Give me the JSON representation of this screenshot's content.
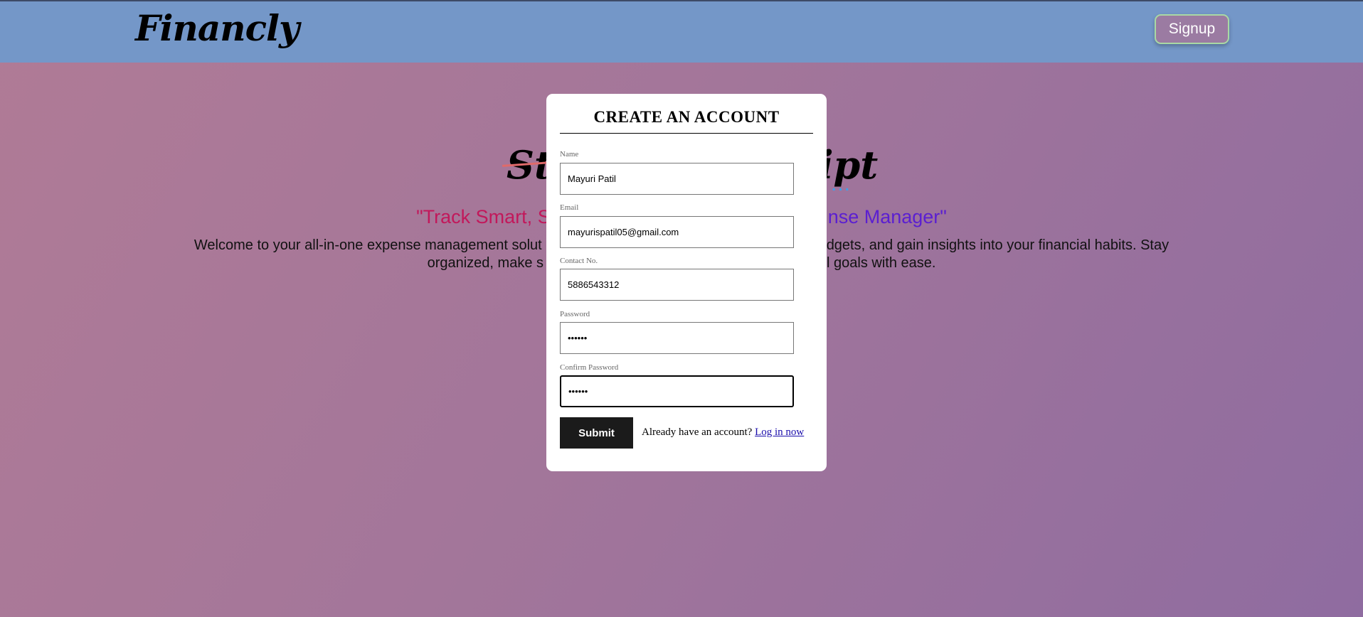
{
  "navbar": {
    "logo": "Financly",
    "signup_label": "Signup"
  },
  "hero": {
    "title_left": "St",
    "title_right": "ipt",
    "title_dots": "...",
    "tagline_left": "\"Track Smart, S",
    "tagline_right": "nse Manager\"",
    "welcome_line1_left": "Welcome to your all-in-one expense management solut",
    "welcome_line1_right": "dgets, and gain insights into your financial habits. Stay",
    "welcome_line2_left": "organized, make s",
    "welcome_line2_right": "l goals with ease."
  },
  "form": {
    "title": "CREATE AN ACCOUNT",
    "fields": [
      {
        "label": "Name",
        "value": "Mayuri Patil"
      },
      {
        "label": "Email",
        "value": "mayurispatil05@gmail.com"
      },
      {
        "label": "Contact No.",
        "value": "5886543312"
      },
      {
        "label": "Password",
        "value": "••••••"
      },
      {
        "label": "Confirm Password",
        "value": "••••••"
      }
    ],
    "submit_label": "Submit",
    "login_prompt": "Already have an account?",
    "login_link": "Log in now"
  },
  "colors": {
    "navbar": "#7497c8",
    "signup_bg": "#9b7ba2",
    "signup_border": "#a9d9a4",
    "tagline_left": "#c2185b",
    "tagline_right": "#5b1fd1",
    "submit_bg": "#1b1b1b"
  }
}
